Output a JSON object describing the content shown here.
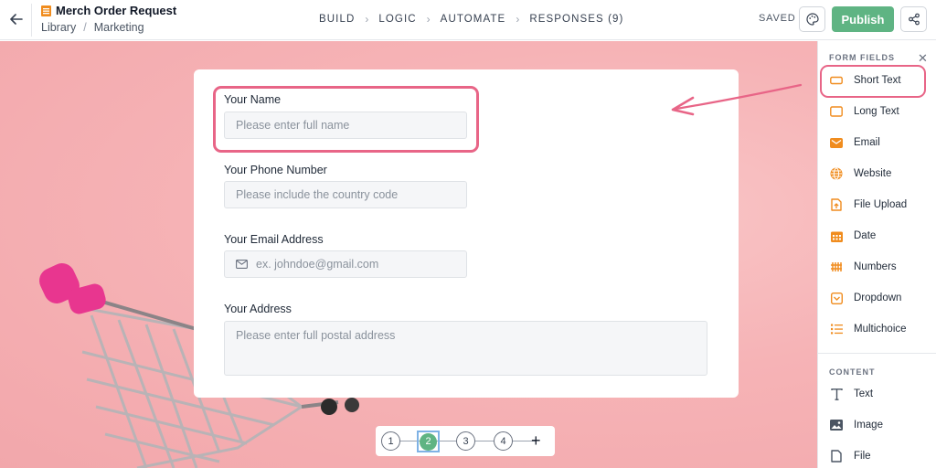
{
  "header": {
    "title": "Merch Order Request",
    "breadcrumb": [
      "Library",
      "Marketing"
    ],
    "steps": [
      "BUILD",
      "LOGIC",
      "AUTOMATE",
      "RESPONSES (9)"
    ],
    "saved_label": "SAVED",
    "publish_label": "Publish"
  },
  "form": {
    "fields": [
      {
        "label": "Your Name",
        "placeholder": "Please enter full name"
      },
      {
        "label": "Your Phone Number",
        "placeholder": "Please include the country code"
      },
      {
        "label": "Your Email Address",
        "placeholder": "ex. johndoe@gmail.com"
      },
      {
        "label": "Your Address",
        "placeholder": "Please enter full postal address"
      }
    ]
  },
  "pager": {
    "pages": [
      "1",
      "2",
      "3",
      "4"
    ],
    "active_page": "2",
    "add_label": "+"
  },
  "panel": {
    "form_fields_heading": "FORM FIELDS",
    "form_fields": [
      {
        "label": "Short Text",
        "icon": "short-text-icon"
      },
      {
        "label": "Long Text",
        "icon": "long-text-icon"
      },
      {
        "label": "Email",
        "icon": "email-icon"
      },
      {
        "label": "Website",
        "icon": "globe-icon"
      },
      {
        "label": "File Upload",
        "icon": "file-upload-icon"
      },
      {
        "label": "Date",
        "icon": "calendar-icon"
      },
      {
        "label": "Numbers",
        "icon": "numbers-icon"
      },
      {
        "label": "Dropdown",
        "icon": "dropdown-icon"
      },
      {
        "label": "Multichoice",
        "icon": "list-icon"
      }
    ],
    "content_heading": "CONTENT",
    "content_items": [
      {
        "label": "Text",
        "icon": "text-icon"
      },
      {
        "label": "Image",
        "icon": "image-icon"
      },
      {
        "label": "File",
        "icon": "file-icon"
      }
    ]
  },
  "colors": {
    "accent": "#5fb483",
    "field_icon": "#f08c1e",
    "highlight": "#e86587",
    "canvas": "#f6b3b6"
  }
}
